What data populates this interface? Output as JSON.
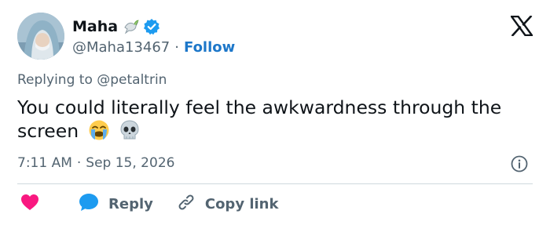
{
  "tweet": {
    "author": {
      "display_name": "Maha",
      "handle": "@Maha13467",
      "avatar_icon": "avatar-photo",
      "name_emoji_icon": "dove-icon",
      "verified_icon": "verified-badge-icon",
      "verified_color": "#1d9bf0"
    },
    "follow_label": "Follow",
    "separator": "·",
    "replying_to_prefix": "Replying to",
    "replying_to_handle": "@petaltrin",
    "text": "You could literally feel the awkwardness through the screen",
    "text_emojis": [
      "loudly-crying-face-icon",
      "skull-icon"
    ],
    "time": "7:11 AM",
    "date": "Sep 15, 2026",
    "platform_logo": "x-logo-icon"
  },
  "actions": {
    "like_icon": "heart-icon",
    "reply_icon": "reply-bubble-icon",
    "reply_label": "Reply",
    "copy_icon": "link-icon",
    "copy_label": "Copy link",
    "info_icon": "info-icon"
  },
  "colors": {
    "link_blue": "#1d77c9",
    "heart": "#f91880",
    "reply_bubble": "#1d9bf0",
    "muted_text": "#536471",
    "primary_text": "#0f1419"
  }
}
